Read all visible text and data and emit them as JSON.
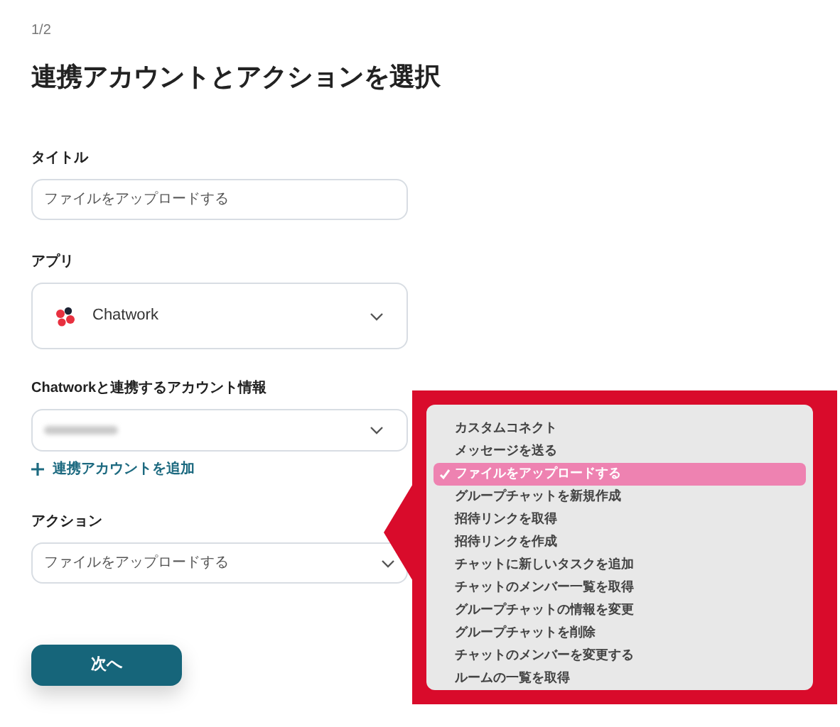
{
  "step": "1/2",
  "heading": "連携アカウントとアクションを選択",
  "fields": [
    {
      "kind": "text",
      "label": "タイトル",
      "value": "ファイルをアップロードする"
    },
    {
      "kind": "app",
      "label": "アプリ",
      "value": "Chatwork"
    },
    {
      "kind": "blurred",
      "label": "Chatworkと連携するアカウント情報"
    },
    {
      "kind": "select",
      "label": "アクション",
      "value": "ファイルをアップロードする"
    }
  ],
  "add_account_link": "連携アカウントを追加",
  "next_button": "次へ",
  "action_menu": [
    {
      "label": "カスタムコネクト",
      "selected": false
    },
    {
      "label": "メッセージを送る",
      "selected": false
    },
    {
      "label": "ファイルをアップロードする",
      "selected": true
    },
    {
      "label": "グループチャットを新規作成",
      "selected": false
    },
    {
      "label": "招待リンクを取得",
      "selected": false
    },
    {
      "label": "招待リンクを作成",
      "selected": false
    },
    {
      "label": "チャットに新しいタスクを追加",
      "selected": false
    },
    {
      "label": "チャットのメンバー一覧を取得",
      "selected": false
    },
    {
      "label": "グループチャットの情報を変更",
      "selected": false
    },
    {
      "label": "グループチャットを削除",
      "selected": false
    },
    {
      "label": "チャットのメンバーを変更する",
      "selected": false
    },
    {
      "label": "ルームの一覧を取得",
      "selected": false
    }
  ]
}
